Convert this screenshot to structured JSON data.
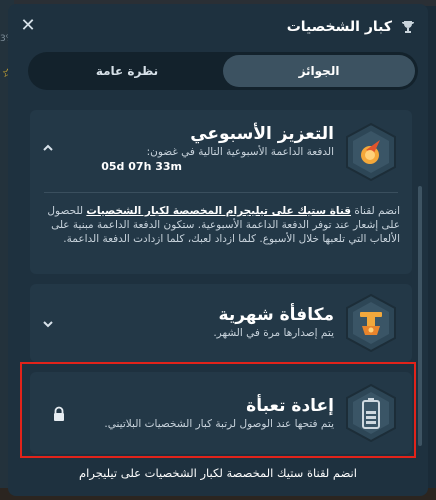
{
  "background": {
    "peek_text": "3%"
  },
  "header": {
    "title": "كبار الشخصيات",
    "icon": "trophy-icon",
    "close_icon": "close-icon"
  },
  "tabs": [
    {
      "label": "الجوائز",
      "active": true
    },
    {
      "label": "نظرة عامة",
      "active": false
    }
  ],
  "cards": {
    "weekly": {
      "title": "التعزيز الأسبوعي",
      "subtitle": "الدفعة الداعمة الأسبوعية التالية في غضون:",
      "timer": "05d 07h 33m",
      "icon": "weekly-boost-badge-icon",
      "expanded": true,
      "body_prefix": "انضم لقناة ",
      "body_link": "قناة ستيك على تيليجرام المخصصة لكبار الشخصيات",
      "body_suffix": " للحصول على إشعار عند توفر الدفعة الداعمة الأسبوعية. ستكون الدفعة الداعمة مبنية على الألعاب التي تلعبها خلال الأسبوع. كلما ازداد لعبك، كلما ازدادت الدفعة الداعمة."
    },
    "monthly": {
      "title": "مكافأة شهرية",
      "subtitle": "يتم إصدارها مرة في الشهر.",
      "icon": "monthly-bonus-badge-icon",
      "expanded": false
    },
    "reload": {
      "title": "إعادة تعبأة",
      "subtitle": "يتم فتحها عند الوصول لرتبة كبار الشخصيات البلاتيني.",
      "icon": "battery-reload-icon",
      "locked": true
    }
  },
  "footer": {
    "link": "انضم لقناة ستيك المخصصة لكبار الشخصيات على تيليجرام"
  },
  "colors": {
    "panel": "#1e313f",
    "card": "#233847",
    "tab_active": "#3c5261",
    "highlight": "#e2231a",
    "accent_orange": "#f7a13a"
  }
}
